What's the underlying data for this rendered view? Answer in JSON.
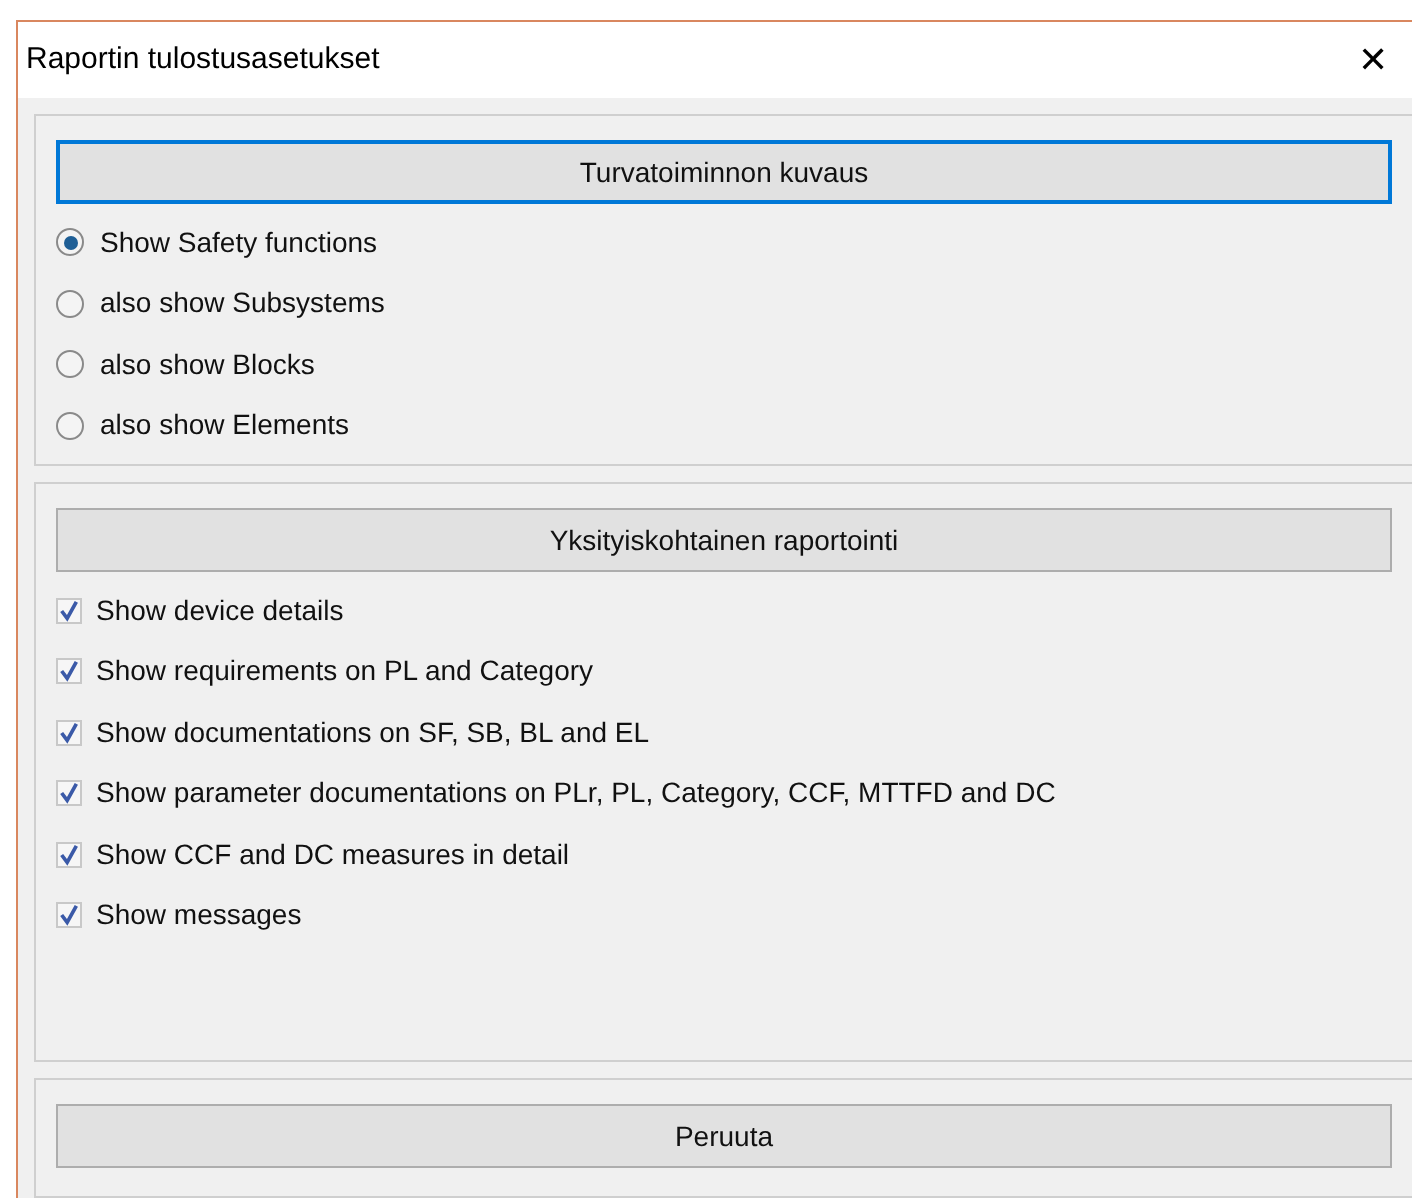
{
  "window": {
    "title": "Raportin tulostusasetukset",
    "close": "✕"
  },
  "description_section": {
    "button": {
      "label": "Turvatoiminnon kuvaus",
      "focused": true
    },
    "options": [
      {
        "label": "Show Safety functions",
        "selected": true
      },
      {
        "label": "also show Subsystems",
        "selected": false
      },
      {
        "label": "also show Blocks",
        "selected": false
      },
      {
        "label": "also show Elements",
        "selected": false
      }
    ]
  },
  "detail_section": {
    "button": {
      "label": "Yksityiskohtainen raportointi",
      "focused": false
    },
    "options": [
      {
        "label": "Show device details",
        "checked": true
      },
      {
        "label": "Show requirements on PL and Category",
        "checked": true
      },
      {
        "label": "Show documentations on SF, SB, BL and EL",
        "checked": true
      },
      {
        "label": "Show parameter documentations on PLr, PL, Category, CCF, MTTFD and DC",
        "checked": true
      },
      {
        "label": "Show CCF and DC measures in detail",
        "checked": true
      },
      {
        "label": "Show messages",
        "checked": true
      }
    ]
  },
  "footer": {
    "button": {
      "label": "Peruuta",
      "focused": false
    }
  }
}
